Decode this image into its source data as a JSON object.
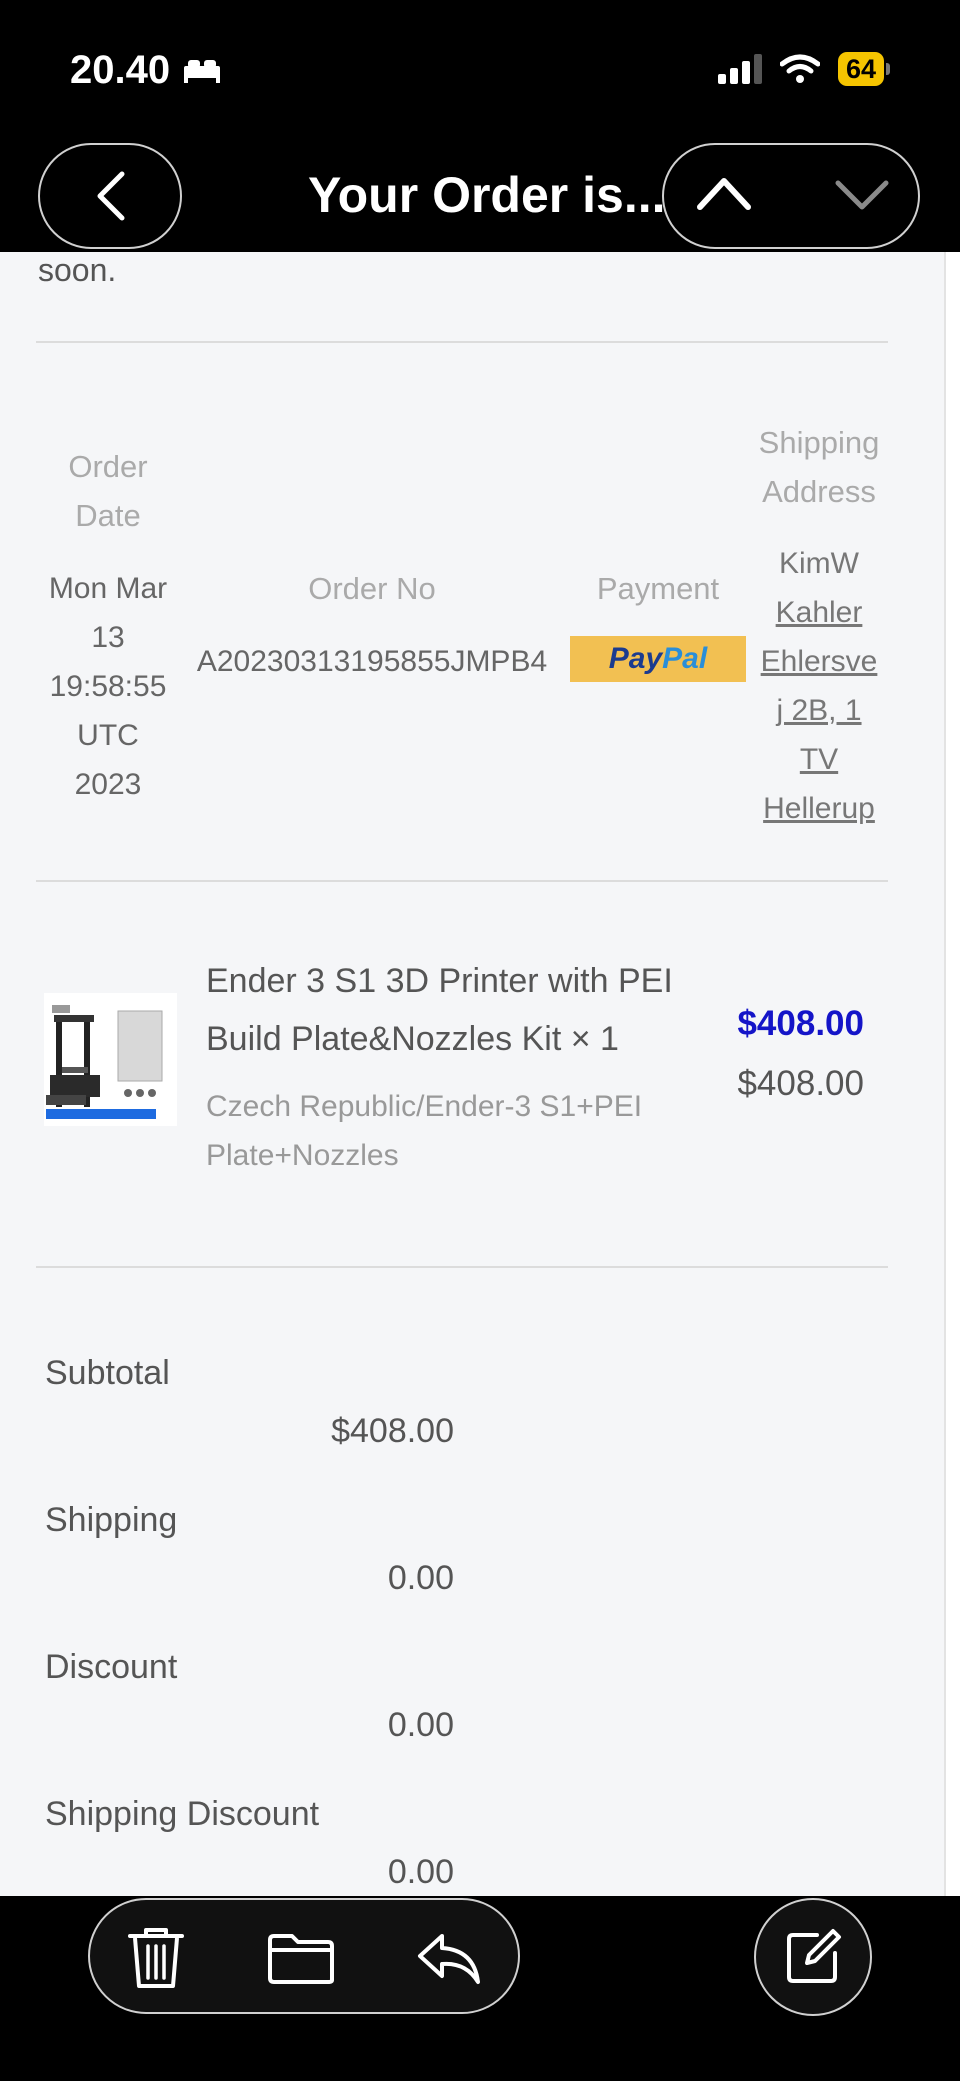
{
  "status_bar": {
    "time": "20.40",
    "battery": "64"
  },
  "nav": {
    "title": "Your Order is..."
  },
  "content": {
    "intro_tail": "soon.",
    "order_info": {
      "order_date_label": [
        "Order",
        "Date"
      ],
      "order_date_value": [
        "Mon Mar",
        "13",
        "19:58:55",
        "UTC",
        "2023"
      ],
      "order_no_label": "Order No",
      "order_no_value": "A20230313195855JMPB4",
      "payment_label": "Payment",
      "payment_method": {
        "pay": "Pay",
        "pal": "Pal"
      },
      "shipping_label": [
        "Shipping",
        "Address"
      ],
      "shipping_value": [
        "KimW",
        "Kahler",
        "Ehlersve",
        "j 2B, 1",
        "TV",
        "Hellerup"
      ]
    },
    "product": {
      "title_lines": [
        "Ender 3 S1 3D Printer with PEI",
        "Build Plate&Nozzles Kit × 1"
      ],
      "variant_lines": [
        "Czech Republic/Ender-3 S1+PEI",
        "Plate+Nozzles"
      ],
      "price": "$408.00",
      "original_price": "$408.00"
    },
    "summary": [
      {
        "label": "Subtotal",
        "value": "$408.00"
      },
      {
        "label": "Shipping",
        "value": "0.00"
      },
      {
        "label": "Discount",
        "value": "0.00"
      },
      {
        "label": "Shipping Discount",
        "value": "0.00"
      }
    ]
  },
  "colors": {
    "price_accent": "#1414c8",
    "paypal_bg": "#f2c052",
    "battery": "#f5c400"
  },
  "icons": [
    "bed-icon",
    "signal-icon",
    "wifi-icon",
    "back-chevron-icon",
    "chevron-up-icon",
    "chevron-down-icon",
    "trash-icon",
    "folder-icon",
    "reply-icon",
    "compose-icon"
  ]
}
